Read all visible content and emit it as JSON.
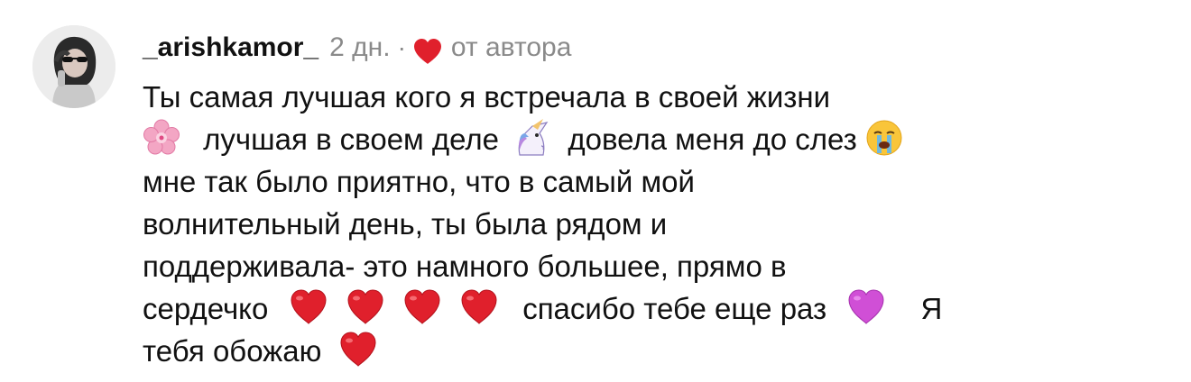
{
  "comment": {
    "username": "_arishkamor_",
    "timestamp": "2 дн.",
    "separator": "·",
    "author_like_icon": "red-heart-icon",
    "author_label": "от автора",
    "lines": [
      {
        "a": "Ты самая лучшая кого я встречала в своей жизни"
      },
      {
        "a": "лучшая в своем деле",
        "b": "довела меня до слез",
        "emojis": [
          "cherry-blossom-icon",
          "unicorn-icon",
          "crying-face-icon"
        ]
      },
      {
        "a": "мне так было приятно, что в самый мой"
      },
      {
        "a": "волнительный день, ты была рядом и"
      },
      {
        "a": "поддерживала- это намного большее, прямо в"
      },
      {
        "a": "сердечко",
        "b": "спасибо тебе еще раз",
        "c": "Я",
        "emojis": [
          "red-heart-icon",
          "red-heart-icon",
          "red-heart-icon",
          "red-heart-icon",
          "purple-heart-icon"
        ]
      },
      {
        "a": "тебя обожаю",
        "emojis": [
          "red-heart-icon"
        ]
      }
    ]
  },
  "colors": {
    "text": "#111111",
    "muted": "#8a8a8a",
    "heart_red": "#e0202c",
    "heart_purple": "#d04fd6"
  }
}
